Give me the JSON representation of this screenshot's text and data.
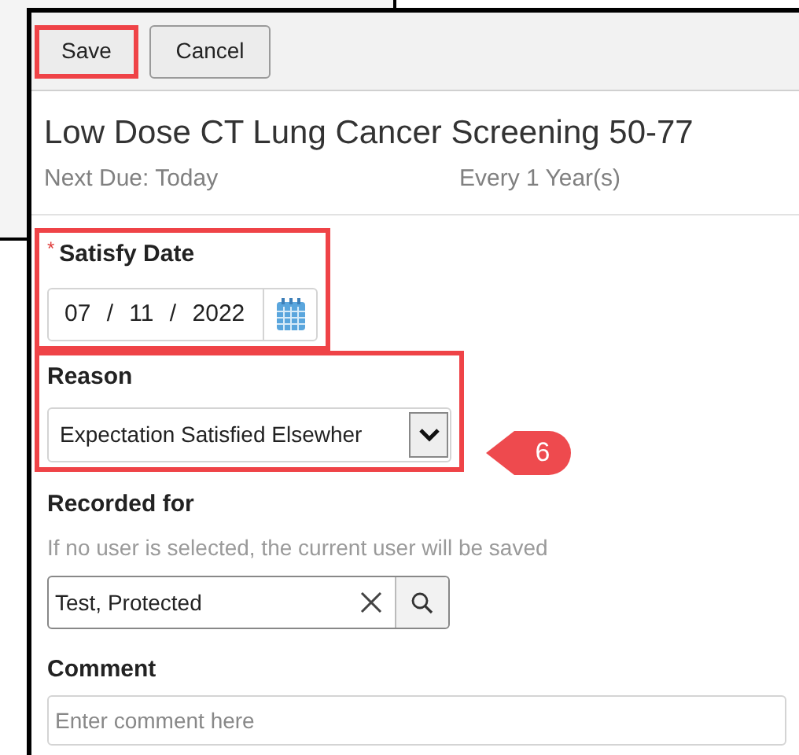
{
  "toolbar": {
    "buttons": [
      {
        "label": "Save",
        "highlighted": true
      },
      {
        "label": "Cancel",
        "highlighted": false
      }
    ]
  },
  "expectation": {
    "title": "Low Dose CT Lung Cancer Screening 50-77",
    "next_due": "Next Due: Today",
    "frequency": "Every 1 Year(s)"
  },
  "fields": [
    {
      "kind": "date",
      "label": "Satisfy Date",
      "required_mark": "*",
      "highlighted": true,
      "value": "07 / 11 / 2022"
    },
    {
      "kind": "select",
      "label": "Reason",
      "highlighted": true,
      "value": "Expectation Satisfied Elsewher"
    },
    {
      "kind": "user_lookup",
      "label": "Recorded for",
      "highlighted": false,
      "hint": "If no user is selected, the current user will be saved",
      "value": "Test, Protected"
    },
    {
      "kind": "text",
      "label": "Comment",
      "highlighted": false,
      "placeholder": "Enter comment here"
    }
  ],
  "callout": {
    "label": "6"
  }
}
